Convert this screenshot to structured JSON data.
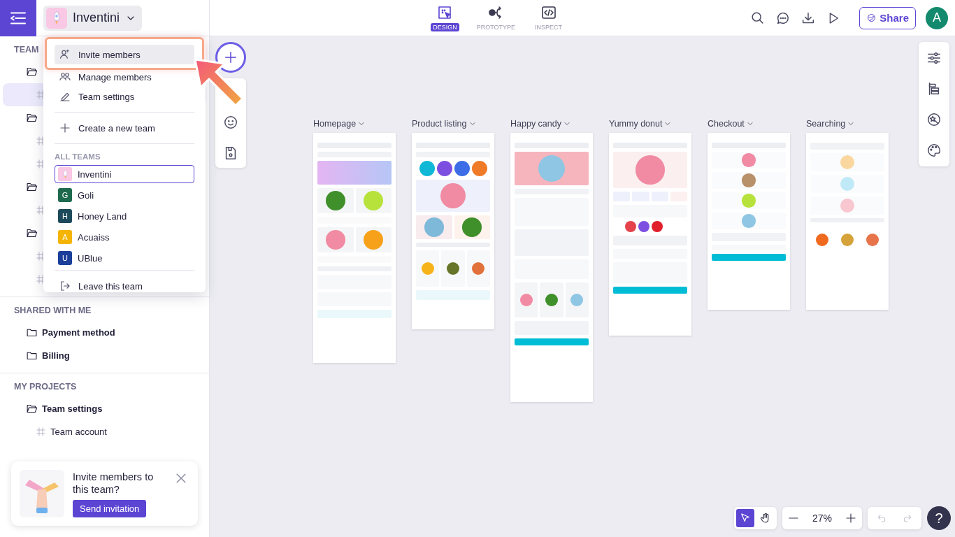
{
  "topbar": {
    "team": "Inventini",
    "tabs": [
      {
        "label": "DESIGN",
        "selected": true
      },
      {
        "label": "PROTOTYPE",
        "selected": false
      },
      {
        "label": "INSPECT",
        "selected": false
      }
    ],
    "share": "Share",
    "avatar": "A"
  },
  "sidebar": {
    "team_section": {
      "title": "TEAM",
      "folders": [
        {
          "expanded": true,
          "children": [
            {
              "selected": true
            }
          ]
        },
        {
          "expanded": true,
          "children": [
            {
              "selected": false
            },
            {
              "selected": false
            }
          ]
        },
        {
          "expanded": true,
          "children": [
            {
              "selected": false
            }
          ]
        },
        {
          "expanded": true,
          "children": [
            {
              "selected": false
            },
            {
              "selected": false
            }
          ]
        }
      ]
    },
    "shared": {
      "title": "SHARED WITH ME",
      "folders": [
        {
          "label": "Payment method",
          "expanded": false
        },
        {
          "label": "Billing",
          "expanded": false
        }
      ]
    },
    "my_projects": {
      "title": "MY PROJECTS",
      "folders": [
        {
          "label": "Team settings",
          "expanded": true,
          "children": [
            {
              "label": "Team account",
              "selected": false
            }
          ]
        }
      ]
    }
  },
  "invite_card": {
    "title": "Invite members to this team?",
    "button": "Send invitation"
  },
  "team_menu": {
    "actions": [
      {
        "label": "Invite members",
        "selected": true
      },
      {
        "label": "Manage members",
        "selected": false
      },
      {
        "label": "Team settings",
        "selected": false
      }
    ],
    "create": "Create a new team",
    "teams_title": "ALL TEAMS",
    "teams": [
      {
        "name": "Inventini",
        "selected": true,
        "color": "#f9c8e4"
      },
      {
        "name": "Goli",
        "initial": "G",
        "selected": false,
        "color": "#1e6a4e"
      },
      {
        "name": "Honey Land",
        "initial": "H",
        "selected": false,
        "color": "#1d4a5a"
      },
      {
        "name": "Acuaiss",
        "initial": "A",
        "selected": false,
        "color": "#f5b400"
      },
      {
        "name": "UBlue",
        "initial": "U",
        "selected": false,
        "color": "#1b3f9a"
      }
    ],
    "leave": "Leave this team"
  },
  "frames": [
    {
      "title": "Homepage",
      "kind": "home"
    },
    {
      "title": "Product listing",
      "kind": "listing"
    },
    {
      "title": "Happy candy",
      "kind": "product"
    },
    {
      "title": "Yummy donut",
      "kind": "detail"
    },
    {
      "title": "Checkout",
      "kind": "checkout"
    },
    {
      "title": "Searching",
      "kind": "search"
    }
  ],
  "tools": [
    {
      "selected": true
    },
    {
      "selected": false
    }
  ],
  "zoom": "27%",
  "history": {
    "disabled": true
  },
  "help": "?"
}
